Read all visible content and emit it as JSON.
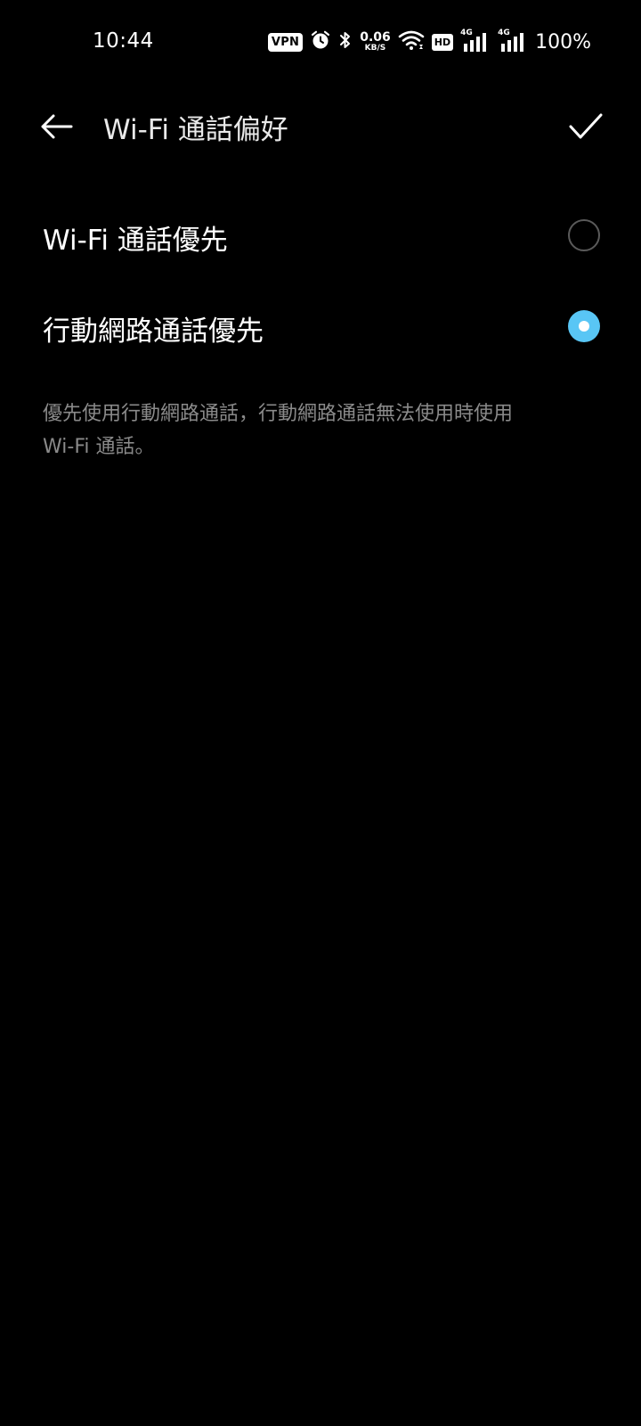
{
  "status_bar": {
    "time": "10:44",
    "vpn_label": "VPN",
    "net_speed_value": "0.06",
    "net_speed_unit": "KB/S",
    "hd_label": "HD",
    "sim1_type": "4G",
    "sim2_type": "4G",
    "battery": "100%"
  },
  "header": {
    "title": "Wi-Fi 通話偏好"
  },
  "options": [
    {
      "label": "Wi-Fi 通話優先",
      "selected": false
    },
    {
      "label": "行動網路通話優先",
      "selected": true
    }
  ],
  "description": {
    "line1": "優先使用行動網路通話，行動網路通話無法使用時使用",
    "line2": "Wi-Fi 通話。"
  },
  "colors": {
    "background": "#000000",
    "accent": "#59c6f5",
    "secondary_text": "#8a8a8a"
  }
}
